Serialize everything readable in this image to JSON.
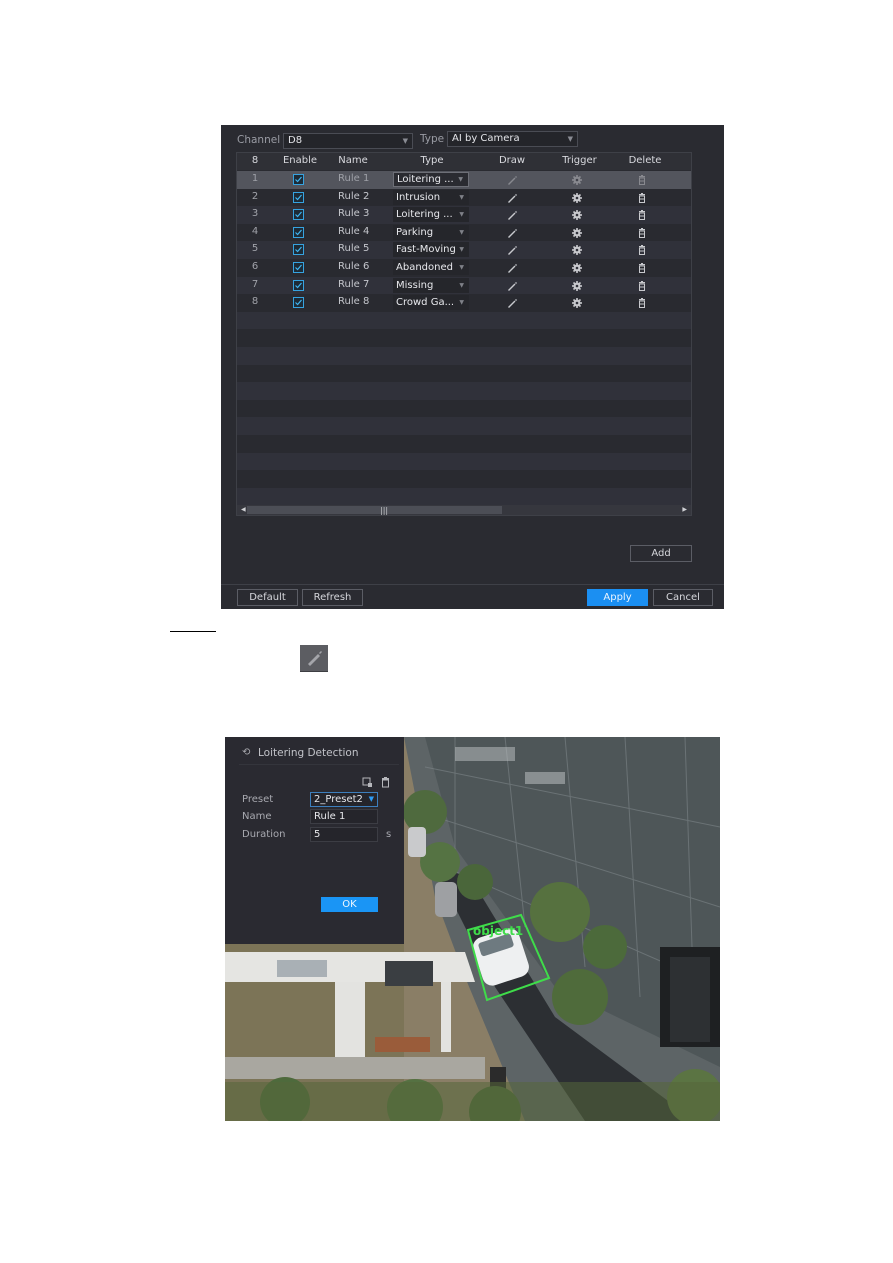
{
  "rules_panel": {
    "channel_label": "Channel",
    "channel_value": "D8",
    "type_label": "Type",
    "type_value": "AI by Camera",
    "columns": [
      "8",
      "Enable",
      "Name",
      "Type",
      "Draw",
      "Trigger",
      "Delete"
    ],
    "rows": [
      {
        "index": "1",
        "enabled": true,
        "name": "Rule 1",
        "type": "Loitering ...",
        "selected": true
      },
      {
        "index": "2",
        "enabled": true,
        "name": "Rule 2",
        "type": "Intrusion",
        "selected": false
      },
      {
        "index": "3",
        "enabled": true,
        "name": "Rule 3",
        "type": "Loitering ...",
        "selected": false
      },
      {
        "index": "4",
        "enabled": true,
        "name": "Rule 4",
        "type": "Parking",
        "selected": false
      },
      {
        "index": "5",
        "enabled": true,
        "name": "Rule 5",
        "type": "Fast-Moving",
        "selected": false
      },
      {
        "index": "6",
        "enabled": true,
        "name": "Rule 6",
        "type": "Abandoned",
        "selected": false
      },
      {
        "index": "7",
        "enabled": true,
        "name": "Rule 7",
        "type": "Missing",
        "selected": false
      },
      {
        "index": "8",
        "enabled": true,
        "name": "Rule 8",
        "type": "Crowd Ga...",
        "selected": false
      }
    ],
    "icons": {
      "draw": "pencil-icon",
      "trigger": "gear-icon",
      "delete": "trash-icon"
    },
    "scrollbar_grip": "|||",
    "add_label": "Add",
    "default_label": "Default",
    "refresh_label": "Refresh",
    "apply_label": "Apply",
    "cancel_label": "Cancel",
    "accent_color": "#1b8ff2"
  },
  "rule_editor": {
    "title": "Loitering Detection",
    "title_icon": "loiter-path-icon",
    "tools": [
      "add-region-icon",
      "trash-icon"
    ],
    "preset_label": "Preset",
    "preset_value": "2_Preset2",
    "name_label": "Name",
    "name_value": "Rule 1",
    "duration_label": "Duration",
    "duration_value": "5",
    "duration_unit": "s",
    "ok_label": "OK",
    "overlay_label": "object1",
    "overlay_color": "#3fdc4a"
  }
}
